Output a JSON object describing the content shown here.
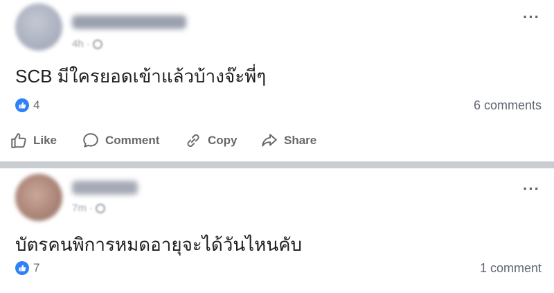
{
  "posts": [
    {
      "text": "SCB มีใครยอดเข้าแล้วบ้างจ๊ะพี่ๆ",
      "time": "4h",
      "reaction_count": "4",
      "comment_count": "6 comments"
    },
    {
      "text": "บัตรคนพิการหมดอายุจะได้วันไหนคับ",
      "time": "7m",
      "reaction_count": "7",
      "comment_count": "1 comment"
    }
  ],
  "actions": {
    "like": "Like",
    "comment": "Comment",
    "copy": "Copy",
    "share": "Share"
  },
  "meta": {
    "separator": "·",
    "more": "···"
  },
  "colors": {
    "like_blue": "#2e81f7",
    "divider": "#c9ccd1",
    "muted_text": "#606770"
  },
  "icons": [
    "like-icon",
    "comment-icon",
    "copy-icon",
    "share-icon",
    "globe-icon",
    "more-icon"
  ]
}
